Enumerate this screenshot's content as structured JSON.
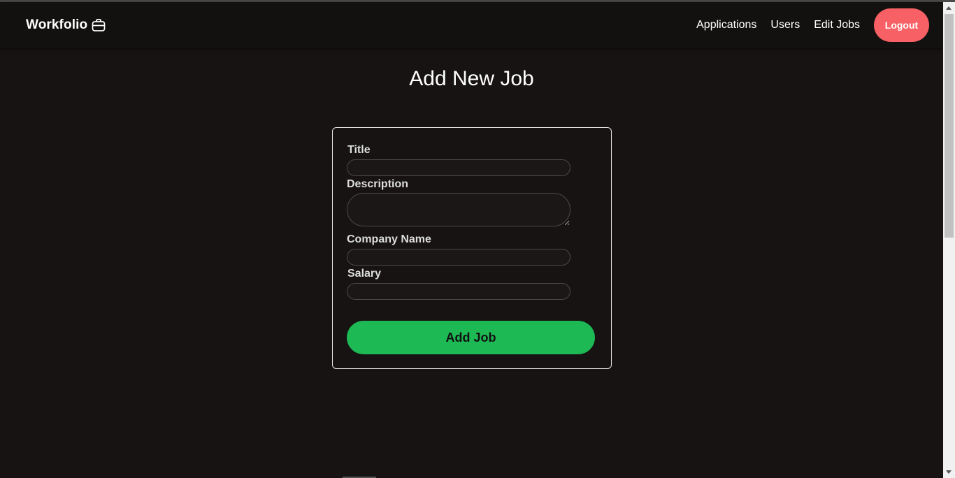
{
  "brand": {
    "name": "Workfolio",
    "icon": "briefcase-icon"
  },
  "nav": {
    "links": [
      "Applications",
      "Users",
      "Edit Jobs"
    ],
    "logout_label": "Logout"
  },
  "page": {
    "title": "Add New Job"
  },
  "form": {
    "title_label": "Title",
    "title_value": "",
    "description_label": "Description",
    "description_value": "",
    "company_label": "Company Name",
    "company_value": "",
    "salary_label": "Salary",
    "salary_value": "",
    "submit_label": "Add Job"
  },
  "colors": {
    "background": "#161312",
    "logout": "#f76065",
    "submit": "#1db954"
  }
}
